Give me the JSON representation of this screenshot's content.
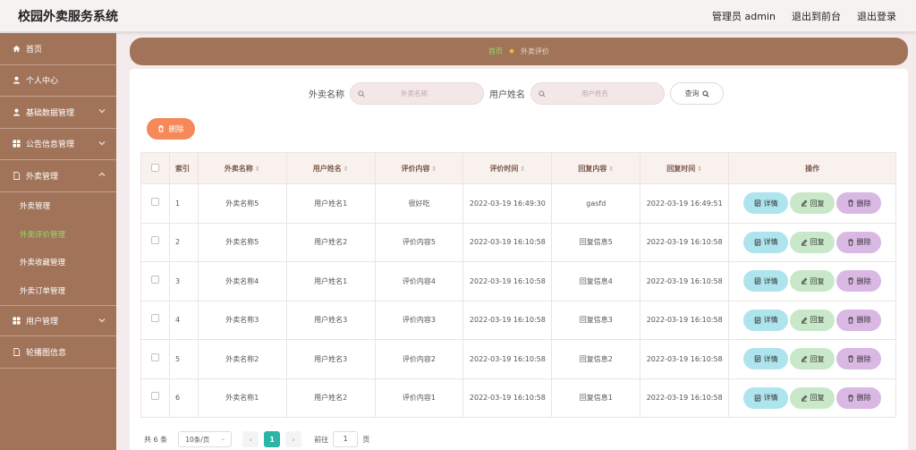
{
  "header": {
    "title": "校园外卖服务系统",
    "admin_label": "管理员 admin",
    "front_label": "退出到前台",
    "logout_label": "退出登录"
  },
  "sidebar": {
    "items": [
      {
        "label": "首页",
        "icon": "home-icon"
      },
      {
        "label": "个人中心",
        "icon": "user-icon"
      },
      {
        "label": "基础数据管理",
        "icon": "user-icon"
      },
      {
        "label": "公告信息管理",
        "icon": "grid-icon"
      },
      {
        "label": "外卖管理",
        "icon": "doc-icon"
      }
    ],
    "sub_items": [
      "外卖管理",
      "外卖评价管理",
      "外卖收藏管理",
      "外卖订单管理"
    ],
    "bottom_items": [
      {
        "label": "用户管理",
        "icon": "grid-icon"
      },
      {
        "label": "轮播图信息",
        "icon": "doc-icon"
      }
    ]
  },
  "breadcrumb": {
    "home": "首页",
    "current": "外卖评价"
  },
  "search": {
    "name_label": "外卖名称",
    "name_placeholder": "外卖名称",
    "user_label": "用户姓名",
    "user_placeholder": "用户姓名",
    "query_label": "查询"
  },
  "actions": {
    "delete_label": "删除"
  },
  "table": {
    "headers": [
      "索引",
      "外卖名称",
      "用户姓名",
      "评价内容",
      "评价时间",
      "回复内容",
      "回复时间",
      "操作"
    ],
    "rows": [
      {
        "idx": "1",
        "name": "外卖名称5",
        "user": "用户姓名1",
        "content": "很好吃",
        "eval_time": "2022-03-19 16:49:30",
        "reply": "gasfd",
        "reply_time": "2022-03-19 16:49:51"
      },
      {
        "idx": "2",
        "name": "外卖名称5",
        "user": "用户姓名2",
        "content": "评价内容5",
        "eval_time": "2022-03-19 16:10:58",
        "reply": "回复信息5",
        "reply_time": "2022-03-19 16:10:58"
      },
      {
        "idx": "3",
        "name": "外卖名称4",
        "user": "用户姓名1",
        "content": "评价内容4",
        "eval_time": "2022-03-19 16:10:58",
        "reply": "回复信息4",
        "reply_time": "2022-03-19 16:10:58"
      },
      {
        "idx": "4",
        "name": "外卖名称3",
        "user": "用户姓名3",
        "content": "评价内容3",
        "eval_time": "2022-03-19 16:10:58",
        "reply": "回复信息3",
        "reply_time": "2022-03-19 16:10:58"
      },
      {
        "idx": "5",
        "name": "外卖名称2",
        "user": "用户姓名3",
        "content": "评价内容2",
        "eval_time": "2022-03-19 16:10:58",
        "reply": "回复信息2",
        "reply_time": "2022-03-19 16:10:58"
      },
      {
        "idx": "6",
        "name": "外卖名称1",
        "user": "用户姓名2",
        "content": "评价内容1",
        "eval_time": "2022-03-19 16:10:58",
        "reply": "回复信息1",
        "reply_time": "2022-03-19 16:10:58"
      }
    ],
    "row_buttons": {
      "detail": "详情",
      "reply": "回复",
      "delete": "删除"
    }
  },
  "pagination": {
    "total_text": "共 6 条",
    "page_size": "10条/页",
    "current_page": "1",
    "goto_label": "前往",
    "goto_value": "1",
    "page_suffix": "页"
  },
  "colors": {
    "sidebar": "#a1745a",
    "accent_green": "#8dde61",
    "delete_orange": "#f5895a",
    "page_active": "#2bb5a5"
  }
}
